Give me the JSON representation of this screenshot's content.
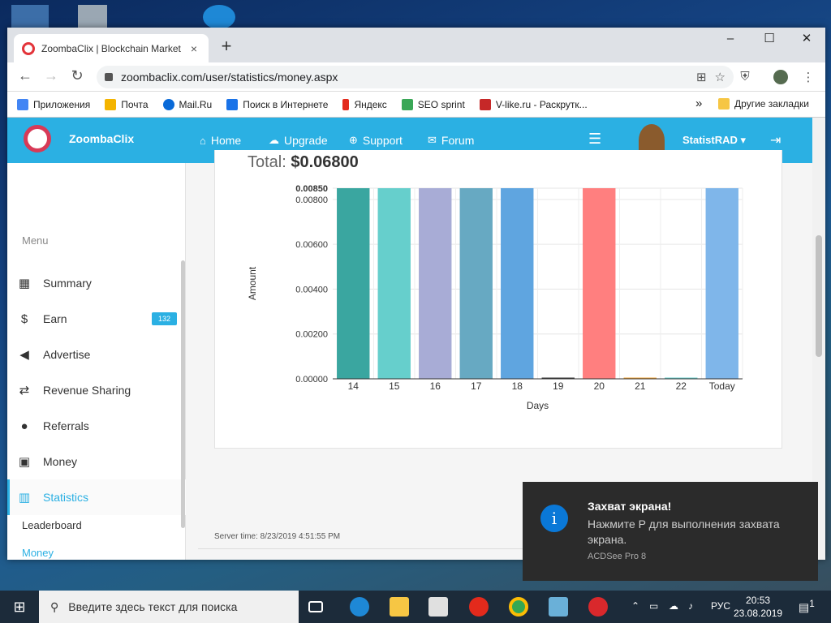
{
  "browser": {
    "tab_title": "ZoombaClix | Blockchain Marketi",
    "tab_close": "×",
    "new_tab": "+",
    "minimize": "–",
    "maximize": "☐",
    "close": "✕",
    "url": "zoombaclix.com/user/statistics/money.aspx"
  },
  "bookmarks": {
    "items": [
      {
        "label": "Приложения",
        "color": "#4285f4"
      },
      {
        "label": "Почта",
        "color": "#f4b400"
      },
      {
        "label": "Mail.Ru",
        "color": "#0a6ad8"
      },
      {
        "label": "Поиск в Интернете",
        "color": "#1a73e8"
      },
      {
        "label": "Яндекс",
        "color": "#e32a1c"
      },
      {
        "label": "SEO sprint",
        "color": "#3aa757"
      },
      {
        "label": "V-like.ru - Раскрутк...",
        "color": "#c62828"
      }
    ],
    "overflow": "»",
    "other": "Другие закладки"
  },
  "site": {
    "brand": "ZoombaClix",
    "nav": [
      {
        "icon": "home-icon",
        "label": "Home"
      },
      {
        "icon": "cloud-upload-icon",
        "label": "Upgrade"
      },
      {
        "icon": "support-icon",
        "label": "Support"
      },
      {
        "icon": "chat-icon",
        "label": "Forum"
      }
    ],
    "username": "StatistRAD",
    "menu_header": "Menu",
    "menu": [
      {
        "icon": "summary-icon",
        "label": "Summary"
      },
      {
        "icon": "dollar-icon",
        "label": "Earn",
        "badge": "132"
      },
      {
        "icon": "megaphone-icon",
        "label": "Advertise"
      },
      {
        "icon": "exchange-icon",
        "label": "Revenue Sharing"
      },
      {
        "icon": "users-icon",
        "label": "Referrals"
      },
      {
        "icon": "money-icon",
        "label": "Money"
      },
      {
        "icon": "bar-chart-icon",
        "label": "Statistics"
      }
    ],
    "submenu": [
      "Leaderboard",
      "Money"
    ],
    "total_label": "Total:",
    "total_value": "$0.06800",
    "server_time": "Server time: 8/23/2019 4:51:55 PM"
  },
  "chart_data": {
    "type": "bar",
    "categories": [
      "14",
      "15",
      "16",
      "17",
      "18",
      "19",
      "20",
      "21",
      "22",
      "Today"
    ],
    "values": [
      0.0085,
      0.0085,
      0.0085,
      0.0085,
      0.0085,
      0,
      0.0085,
      0,
      0,
      0.0085
    ],
    "colors": [
      "#3aa6a0",
      "#66cfcc",
      "#a8acd6",
      "#67a9c2",
      "#5fa5e0",
      "#333333",
      "#ff7f7f",
      "#f0a030",
      "#66cfcc",
      "#7fb6ea"
    ],
    "yticks": [
      "0.00000",
      "0.00200",
      "0.00400",
      "0.00600",
      "0.00800",
      "0.00850"
    ],
    "ytick_values": [
      0,
      0.002,
      0.004,
      0.006,
      0.008,
      0.0085
    ],
    "ylim": [
      0,
      0.0085
    ],
    "xlabel": "Days",
    "ylabel": "Amount",
    "grid": true
  },
  "notification": {
    "icon": "i",
    "title": "Захват экрана!",
    "body": "Нажмите P для выполнения захвата экрана.",
    "app": "ACDSee Pro 8"
  },
  "taskbar": {
    "search_placeholder": "Введите здесь текст для поиска",
    "lang": "РУС",
    "time": "20:53",
    "date": "23.08.2019",
    "notif_count": "1"
  }
}
